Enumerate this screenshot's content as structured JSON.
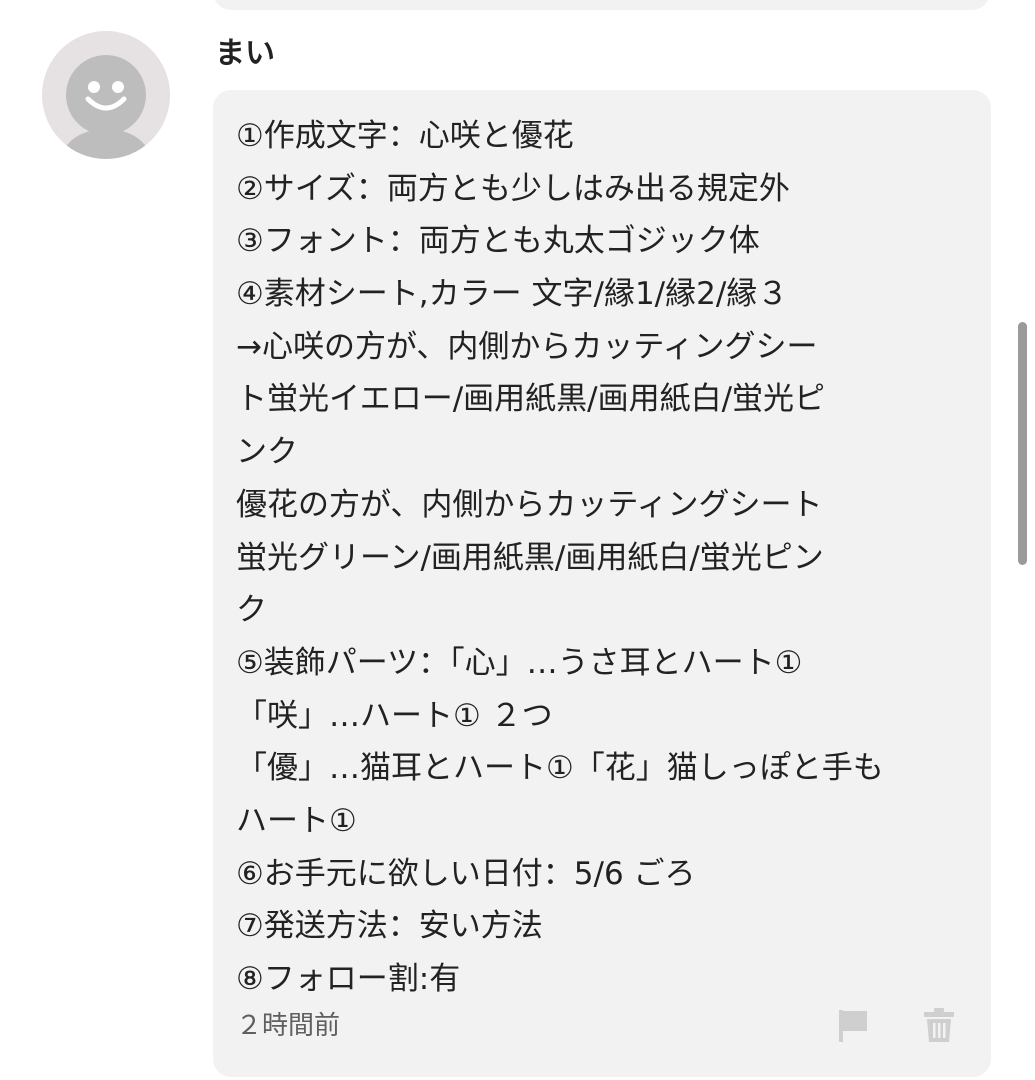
{
  "comment": {
    "username": "まい",
    "lines": [
      "①作成文字：心咲と優花",
      "②サイズ：両方とも少しはみ出る規定外",
      "③フォント：両方とも丸太ゴジック体",
      "④素材シート,カラー 文字/縁1/縁2/縁３",
      "→心咲の方が、内側からカッティングシー",
      "ト蛍光イエロー/画用紙黒/画用紙白/蛍光ピ",
      "ンク",
      "優花の方が、内側からカッティングシート",
      "蛍光グリーン/画用紙黒/画用紙白/蛍光ピン",
      "ク",
      "⑤装飾パーツ：「心」…うさ耳とハート①",
      "「咲」…ハート① ２つ",
      "「優」…猫耳とハート①「花」猫しっぽと手も",
      "ハート①",
      "⑥お手元に欲しい日付：5/6 ごろ",
      "⑦発送方法：安い方法",
      "⑧フォロー割:有"
    ],
    "timestamp": "２時間前"
  },
  "icons": {
    "avatar": "default-user-avatar",
    "report": "flag-icon",
    "delete": "trash-icon"
  },
  "colors": {
    "bubble": "#f2f2f2",
    "text": "#222222",
    "muted": "#5f5f5f",
    "icon": "#cfcfcf"
  }
}
